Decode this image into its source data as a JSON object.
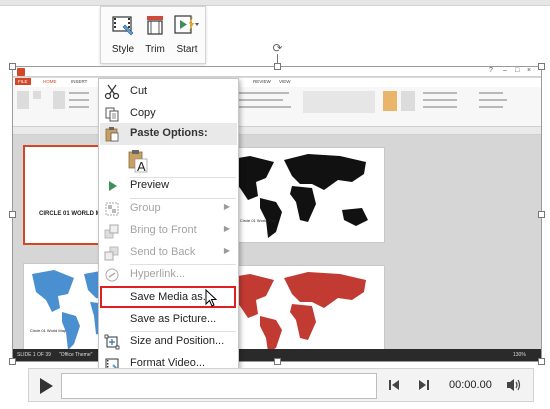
{
  "mini_toolbar": {
    "style_label": "Style",
    "trim_label": "Trim",
    "start_label": "Start"
  },
  "powerpoint": {
    "tabs": [
      "FILE",
      "HOME",
      "INSERT",
      "REVIEW",
      "VIEW"
    ],
    "ribbon_groups": [
      "Clipboard",
      "Slides",
      "Paragraph",
      "Drawing",
      "Editing"
    ],
    "ribbon_items": [
      "Layout",
      "Reset",
      "Section",
      "Text Direction",
      "Align Text",
      "Convert to SmartArt",
      "Shape Fill",
      "Shape Outline",
      "Shape Effects",
      "Find",
      "Replace",
      "Select"
    ],
    "slide1_title": "CIRCLE 01 WORLD M",
    "map_caption": "Circle 01 World Map",
    "status_text": "SLIDE 1 OF 39",
    "status_theme": "\"Office Theme\"",
    "zoom": "130%",
    "map_colors": {
      "black": "#111111",
      "blue": "#4a8fd0",
      "red": "#c23b32"
    },
    "accent": "#d24726"
  },
  "context_menu": {
    "cut": "Cut",
    "copy": "Copy",
    "paste_options": "Paste Options:",
    "preview": "Preview",
    "group": "Group",
    "bring_to_front": "Bring to Front",
    "send_to_back": "Send to Back",
    "hyperlink": "Hyperlink...",
    "save_media": "Save Media as...",
    "save_picture": "Save as Picture...",
    "size_position": "Size and Position...",
    "format_video": "Format Video..."
  },
  "player": {
    "time": "00:00.00"
  }
}
